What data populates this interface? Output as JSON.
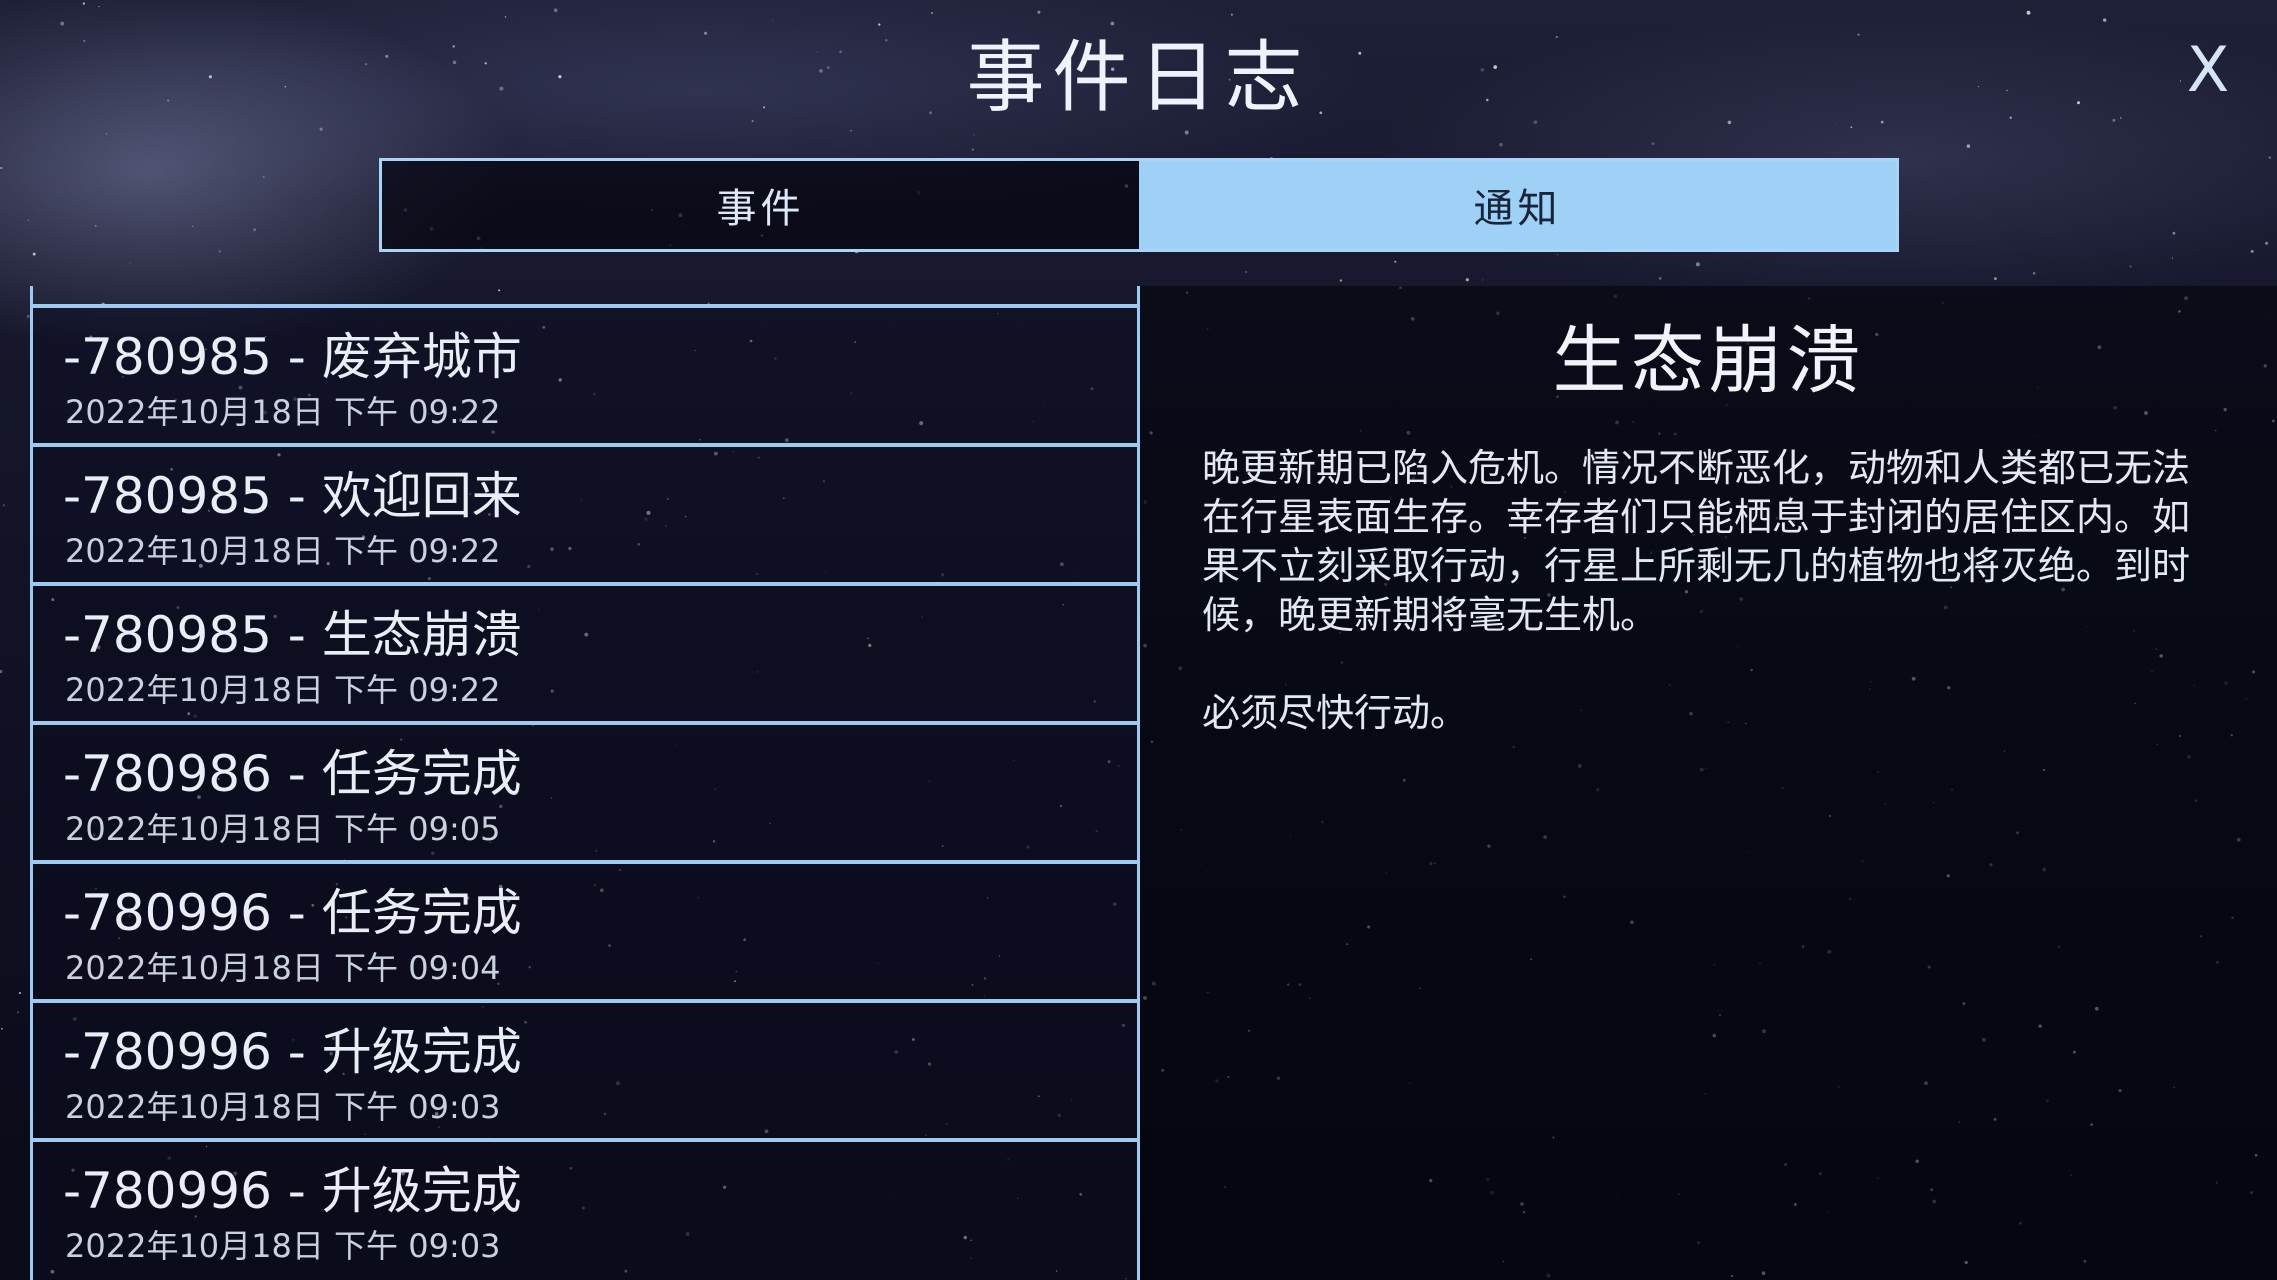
{
  "header": {
    "title": "事件日志",
    "close_label": "X"
  },
  "tabs": [
    {
      "label": "事件",
      "active": false
    },
    {
      "label": "通知",
      "active": true
    }
  ],
  "list": {
    "items": [
      {
        "title": "-780985 - 废弃城市",
        "time": "2022年10月18日 下午 09:22"
      },
      {
        "title": "-780985 - 欢迎回来",
        "time": "2022年10月18日 下午 09:22"
      },
      {
        "title": "-780985 - 生态崩溃",
        "time": "2022年10月18日 下午 09:22"
      },
      {
        "title": "-780986 - 任务完成",
        "time": "2022年10月18日 下午 09:05"
      },
      {
        "title": "-780996 - 任务完成",
        "time": "2022年10月18日 下午 09:04"
      },
      {
        "title": "-780996 - 升级完成",
        "time": "2022年10月18日 下午 09:03"
      },
      {
        "title": "-780996 - 升级完成",
        "time": "2022年10月18日 下午 09:03"
      }
    ]
  },
  "detail": {
    "title": "生态崩溃",
    "paragraphs": [
      "晚更新期已陷入危机。情况不断恶化，动物和人类都已无法在行星表面生存。幸存者们只能栖息于封闭的居住区内。如果不立刻采取行动，行星上所剩无几的植物也将灭绝。到时候，晚更新期将毫无生机。",
      "必须尽快行动。"
    ]
  },
  "colors": {
    "accent": "#9fd0f6",
    "border": "#9ccbf2",
    "background": "#0c0d1c"
  }
}
